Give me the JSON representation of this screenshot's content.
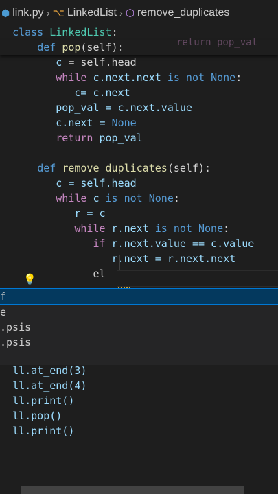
{
  "breadcrumb": {
    "file": "link.py",
    "class": "LinkedList",
    "method": "remove_duplicates"
  },
  "sticky": {
    "class_kw": "class",
    "class_name": "LinkedList",
    "def_kw": "def",
    "pop_name": "pop",
    "pop_params": "(self):",
    "ghost": "return pop_val"
  },
  "code": {
    "l1_var": "c",
    "l1_rest": " = self.head",
    "l2_kw": "while",
    "l2_expr": " c.next.next ",
    "l2_is": "is not",
    "l2_none": "None",
    "l2_colon": ":",
    "l3_text": "c= c.next",
    "l4_var": "pop_val",
    "l4_rest": " = c.next.value",
    "l5_text": "c.next = ",
    "l5_none": "None",
    "l6_kw": "return",
    "l6_rest": " pop_val",
    "l8_kw": "def",
    "l8_name": "remove_duplicates",
    "l8_params": "(self):",
    "l9_text": "c = self.head",
    "l10_kw": "while",
    "l10_expr": " c ",
    "l10_is": "is not",
    "l10_none": "None",
    "l10_colon": ":",
    "l11_text": "r = c",
    "l12_kw": "while",
    "l12_expr": " r.next ",
    "l12_is": "is not",
    "l12_none": "None",
    "l12_colon": ":",
    "l13_kw": "if",
    "l13_rest": " r.next.value == c.value",
    "l14_text": "r.next = r.next.next",
    "l15_text": "el"
  },
  "suggest": {
    "items": [
      "f",
      "e",
      ".psis",
      ".psis",
      ""
    ]
  },
  "code2": {
    "lines": [
      "ll.at_end(3)",
      "ll.at_end(4)",
      "ll.print()",
      "ll.pop()",
      "ll.print()"
    ]
  }
}
